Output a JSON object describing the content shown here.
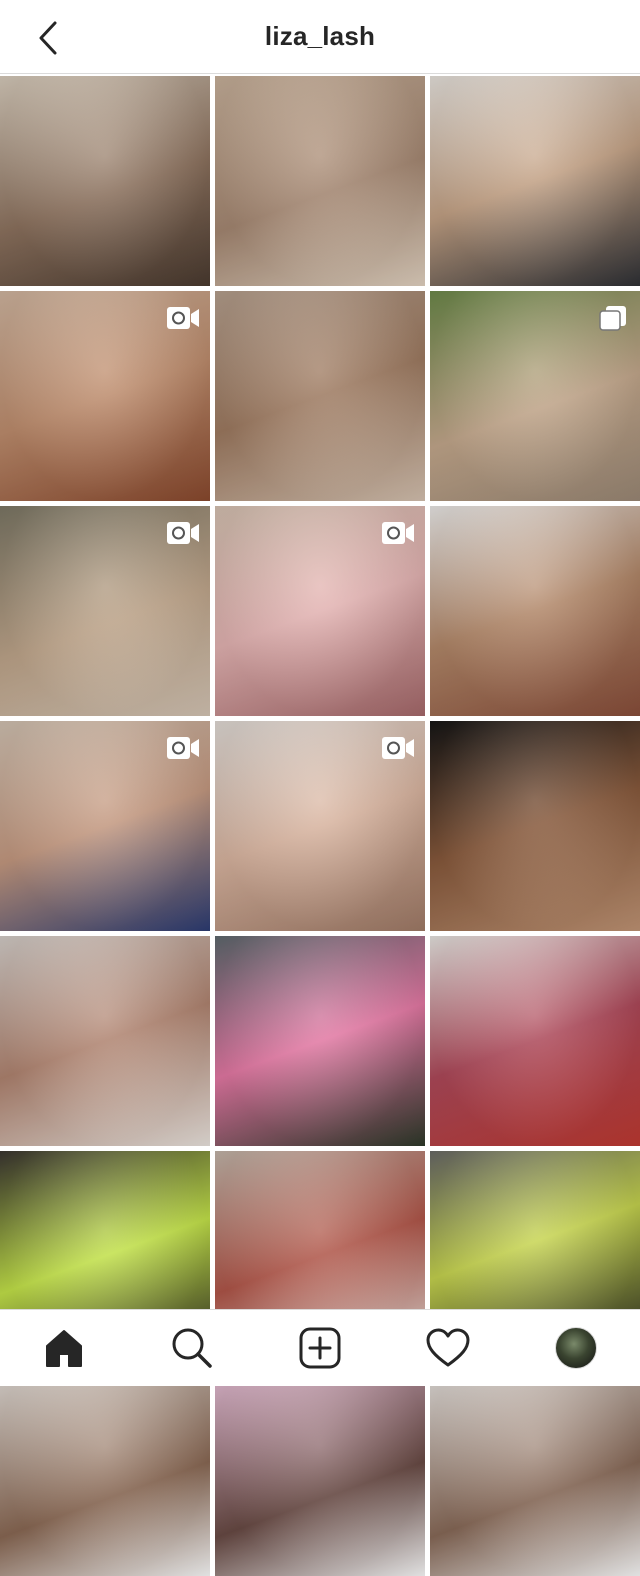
{
  "header": {
    "username": "liza_lash"
  },
  "grid": {
    "tiles": [
      {
        "label": "photo-1",
        "kind": "photo"
      },
      {
        "label": "photo-2",
        "kind": "photo"
      },
      {
        "label": "photo-3",
        "kind": "photo"
      },
      {
        "label": "video-1",
        "kind": "video"
      },
      {
        "label": "photo-4",
        "kind": "photo"
      },
      {
        "label": "carousel-1",
        "kind": "carousel"
      },
      {
        "label": "video-2",
        "kind": "video"
      },
      {
        "label": "video-3",
        "kind": "video"
      },
      {
        "label": "photo-5",
        "kind": "photo"
      },
      {
        "label": "video-4",
        "kind": "video"
      },
      {
        "label": "video-5",
        "kind": "video"
      },
      {
        "label": "photo-6",
        "kind": "photo"
      },
      {
        "label": "photo-7",
        "kind": "photo"
      },
      {
        "label": "photo-8",
        "kind": "photo"
      },
      {
        "label": "photo-9",
        "kind": "photo"
      },
      {
        "label": "photo-10",
        "kind": "photo"
      },
      {
        "label": "photo-11",
        "kind": "photo"
      },
      {
        "label": "photo-12",
        "kind": "photo"
      },
      {
        "label": "photo-13",
        "kind": "photo"
      },
      {
        "label": "photo-14",
        "kind": "photo"
      },
      {
        "label": "photo-15",
        "kind": "photo"
      }
    ]
  },
  "nav": {
    "items": [
      {
        "name": "home",
        "icon": "home-icon"
      },
      {
        "name": "search",
        "icon": "search-icon"
      },
      {
        "name": "create",
        "icon": "plus-square-icon"
      },
      {
        "name": "activity",
        "icon": "heart-icon"
      },
      {
        "name": "profile",
        "icon": "avatar"
      }
    ]
  }
}
